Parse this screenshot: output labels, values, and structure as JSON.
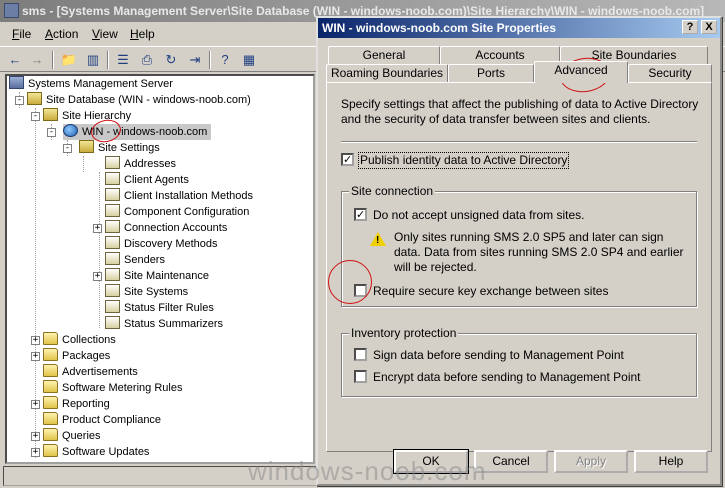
{
  "mmc": {
    "title": "sms - [Systems Management Server\\Site Database (WIN - windows-noob.com)\\Site Hierarchy\\WIN - windows-noob.com]",
    "menus": [
      {
        "pre": "",
        "u": "F",
        "post": "ile"
      },
      {
        "pre": "",
        "u": "A",
        "post": "ction"
      },
      {
        "pre": "",
        "u": "V",
        "post": "iew"
      },
      {
        "pre": "",
        "u": "H",
        "post": "elp"
      }
    ],
    "tree": {
      "root": "Systems Management Server",
      "site_database": "Site Database (WIN - windows-noob.com)",
      "site_hierarchy": "Site Hierarchy",
      "site": "WIN - windows-noob.com",
      "site_settings": "Site Settings",
      "site_settings_children": [
        "Addresses",
        "Client Agents",
        "Client Installation Methods",
        "Component Configuration",
        "Connection Accounts",
        "Discovery Methods",
        "Senders",
        "Site Maintenance",
        "Site Systems",
        "Status Filter Rules",
        "Status Summarizers"
      ],
      "db_children": [
        "Collections",
        "Packages",
        "Advertisements",
        "Software Metering Rules",
        "Reporting",
        "Product Compliance",
        "Queries",
        "Software Updates"
      ]
    }
  },
  "dialog": {
    "title": "WIN - windows-noob.com Site Properties",
    "help_button": "?",
    "close_button": "X",
    "tabs_back": [
      "General",
      "Accounts",
      "Site Boundaries"
    ],
    "tabs_front": [
      "Roaming Boundaries",
      "Ports",
      "Advanced",
      "Security"
    ],
    "active_tab": "Advanced",
    "description": "Specify settings that affect the publishing of data to Active Directory and the security of data transfer between sites and clients.",
    "publish_ad": {
      "label": "Publish identity data to Active Directory",
      "checked": true
    },
    "site_connection": {
      "label": "Site connection",
      "unsigned": {
        "label": "Do not accept unsigned data from sites.",
        "checked": true
      },
      "warning": "Only sites running SMS 2.0 SP5 and later can sign data. Data from sites running SMS 2.0 SP4 and earlier will be rejected.",
      "secure_key": {
        "label": "Require secure key exchange between sites",
        "checked": false
      }
    },
    "inventory": {
      "label": "Inventory protection",
      "sign": {
        "label": "Sign data before sending to Management Point",
        "checked": false
      },
      "encrypt": {
        "label": "Encrypt data before sending to Management Point",
        "checked": false
      }
    },
    "buttons": {
      "ok": "OK",
      "cancel": "Cancel",
      "apply": "Apply",
      "help": "Help"
    }
  },
  "watermark": "windows-noob.com",
  "colors": {
    "active_title": "#0a246a",
    "inactive_title": "#7d7d7d",
    "annotation": "#d01010"
  }
}
